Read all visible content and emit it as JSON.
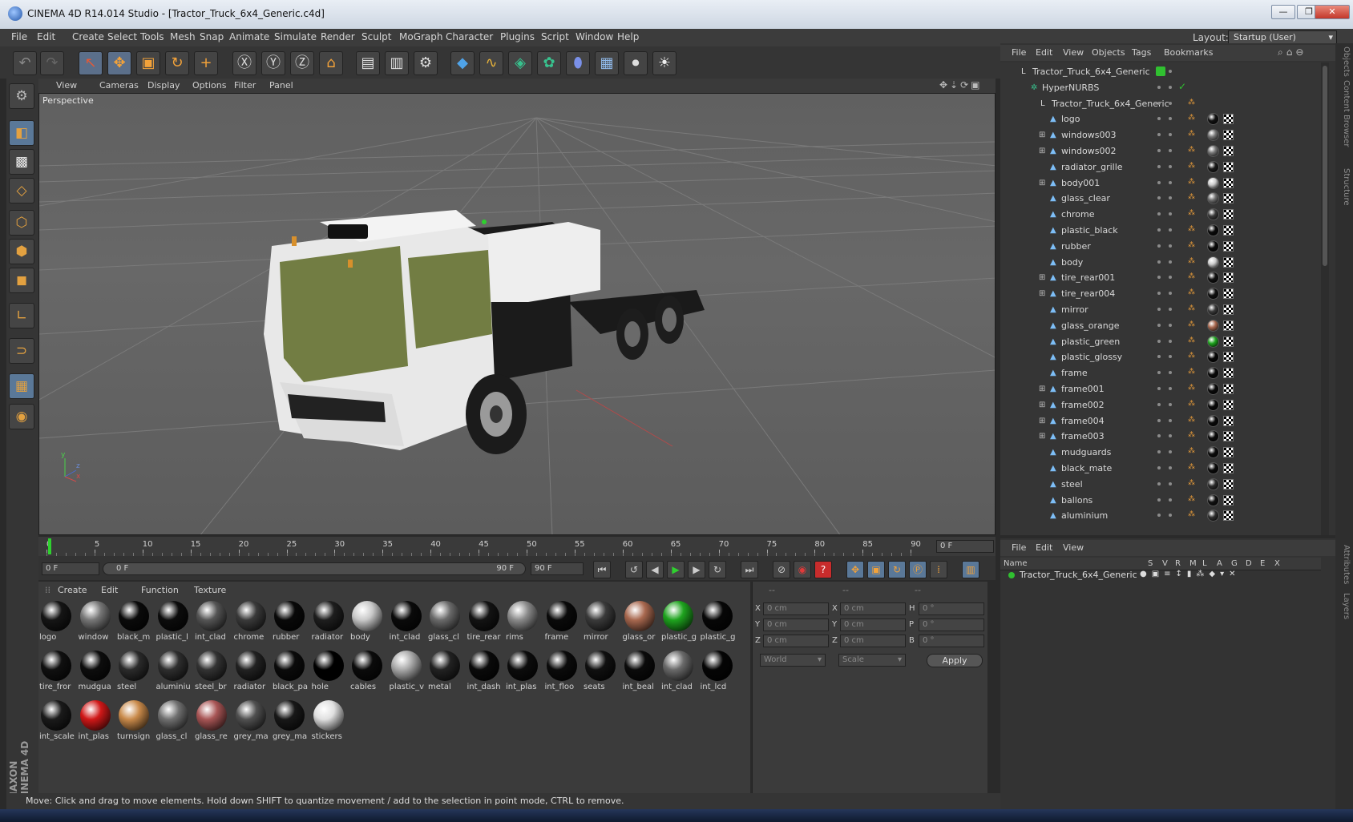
{
  "window": {
    "title": "CINEMA 4D R14.014 Studio - [Tractor_Truck_6x4_Generic.c4d]",
    "buttons": {
      "minimize": "—",
      "maximize": "❐",
      "close": "✕"
    }
  },
  "menubar": {
    "items": [
      "File",
      "Edit",
      "Create",
      "Select",
      "Tools",
      "Mesh",
      "Snap",
      "Animate",
      "Simulate",
      "Render",
      "Sculpt",
      "MoGraph",
      "Character",
      "Plugins",
      "Script",
      "Window",
      "Help"
    ],
    "layout_label": "Layout:",
    "layout_value": "Startup (User)"
  },
  "viewport": {
    "menu": [
      "View",
      "Cameras",
      "Display",
      "Options",
      "Filter",
      "Panel"
    ],
    "label": "Perspective",
    "axes": {
      "y": "y",
      "z": "z",
      "x": "x"
    }
  },
  "timeline": {
    "ticks": [
      "0",
      "5",
      "10",
      "15",
      "20",
      "25",
      "30",
      "35",
      "40",
      "45",
      "50",
      "55",
      "60",
      "65",
      "70",
      "75",
      "80",
      "85",
      "90"
    ],
    "current_frame": "0 F",
    "start_field": "0 F",
    "slider_start": "0 F",
    "slider_end": "90 F",
    "end_field": "90 F"
  },
  "materials": {
    "menu": [
      "Create",
      "Edit",
      "Function",
      "Texture"
    ],
    "items": [
      {
        "label": "logo",
        "color": "#151515"
      },
      {
        "label": "window",
        "color": "#777777"
      },
      {
        "label": "black_m",
        "color": "#0a0a0a"
      },
      {
        "label": "plastic_l",
        "color": "#0c0c0c"
      },
      {
        "label": "int_clad",
        "color": "#555555"
      },
      {
        "label": "chrome",
        "color": "#3a3a3a"
      },
      {
        "label": "rubber",
        "color": "#090909"
      },
      {
        "label": "radiator",
        "color": "#1e1e1e"
      },
      {
        "label": "body",
        "color": "#c9c9c9"
      },
      {
        "label": "int_clad",
        "color": "#0a0a0a"
      },
      {
        "label": "glass_cl",
        "color": "#6a6a6a"
      },
      {
        "label": "tire_rear",
        "color": "#131313"
      },
      {
        "label": "rims",
        "color": "#8a8a8a"
      },
      {
        "label": "frame",
        "color": "#0a0a0a"
      },
      {
        "label": "mirror",
        "color": "#3a3a3a"
      },
      {
        "label": "glass_or",
        "color": "#a8684f"
      },
      {
        "label": "plastic_g",
        "color": "#1ea31e"
      },
      {
        "label": "plastic_g",
        "color": "#070707"
      },
      {
        "label": "tire_fror",
        "color": "#101010"
      },
      {
        "label": "mudgua",
        "color": "#0d0d0d"
      },
      {
        "label": "steel",
        "color": "#2b2b2b"
      },
      {
        "label": "aluminiu",
        "color": "#2e2e2e"
      },
      {
        "label": "steel_br",
        "color": "#333333"
      },
      {
        "label": "radiator",
        "color": "#222222"
      },
      {
        "label": "black_pa",
        "color": "#0b0b0b"
      },
      {
        "label": "hole",
        "color": "#000000"
      },
      {
        "label": "cables",
        "color": "#0b0b0b"
      },
      {
        "label": "plastic_v",
        "color": "#aaaaaa"
      },
      {
        "label": "metal",
        "color": "#222222"
      },
      {
        "label": "int_dash",
        "color": "#0a0a0a"
      },
      {
        "label": "int_plas",
        "color": "#0c0c0c"
      },
      {
        "label": "int_floo",
        "color": "#0b0b0b"
      },
      {
        "label": "seats",
        "color": "#101010"
      },
      {
        "label": "int_beal",
        "color": "#0b0b0b"
      },
      {
        "label": "int_clad",
        "color": "#6a6a6a"
      },
      {
        "label": "int_lcd",
        "color": "#050505"
      },
      {
        "label": "int_scale",
        "color": "#1a1a1a"
      },
      {
        "label": "int_plas",
        "color": "#d01818"
      },
      {
        "label": "turnsign",
        "color": "#c98a4a"
      },
      {
        "label": "glass_cl",
        "color": "#707070"
      },
      {
        "label": "glass_re",
        "color": "#a85555"
      },
      {
        "label": "grey_ma",
        "color": "#505050"
      },
      {
        "label": "grey_ma",
        "color": "#181818"
      },
      {
        "label": "stickers",
        "color": "#e0e0e0"
      }
    ]
  },
  "coords": {
    "headers": [
      "--",
      "--",
      "--"
    ],
    "rows": [
      {
        "a": "X",
        "av": "0 cm",
        "b": "X",
        "bv": "0 cm",
        "c": "H",
        "cv": "0 °"
      },
      {
        "a": "Y",
        "av": "0 cm",
        "b": "Y",
        "bv": "0 cm",
        "c": "P",
        "cv": "0 °"
      },
      {
        "a": "Z",
        "av": "0 cm",
        "b": "Z",
        "bv": "0 cm",
        "c": "B",
        "cv": "0 °"
      }
    ],
    "mode": "World",
    "scale": "Scale",
    "apply": "Apply"
  },
  "objects": {
    "menu": [
      "File",
      "Edit",
      "View",
      "Objects",
      "Tags",
      "Bookmarks"
    ],
    "items": [
      {
        "name": "Tractor_Truck_6x4_Generic",
        "indent": 0,
        "ball": ""
      },
      {
        "name": "HyperNURBS",
        "indent": 1,
        "ball": ""
      },
      {
        "name": "Tractor_Truck_6x4_Generic",
        "indent": 2,
        "ball": ""
      },
      {
        "name": "logo",
        "indent": 3,
        "ball": "#111111"
      },
      {
        "name": "windows003",
        "indent": 3,
        "ball": "#777777"
      },
      {
        "name": "windows002",
        "indent": 3,
        "ball": "#777777"
      },
      {
        "name": "radiator_grille",
        "indent": 3,
        "ball": "#1a1a1a"
      },
      {
        "name": "body001",
        "indent": 3,
        "ball": "#cccccc"
      },
      {
        "name": "glass_clear",
        "indent": 3,
        "ball": "#707070"
      },
      {
        "name": "chrome",
        "indent": 3,
        "ball": "#3a3a3a"
      },
      {
        "name": "plastic_black",
        "indent": 3,
        "ball": "#0a0a0a"
      },
      {
        "name": "rubber",
        "indent": 3,
        "ball": "#0a0a0a"
      },
      {
        "name": "body",
        "indent": 3,
        "ball": "#cccccc"
      },
      {
        "name": "tire_rear001",
        "indent": 3,
        "ball": "#111111"
      },
      {
        "name": "tire_rear004",
        "indent": 3,
        "ball": "#111111"
      },
      {
        "name": "mirror",
        "indent": 3,
        "ball": "#3a3a3a"
      },
      {
        "name": "glass_orange",
        "indent": 3,
        "ball": "#a8684f"
      },
      {
        "name": "plastic_green",
        "indent": 3,
        "ball": "#1ea31e"
      },
      {
        "name": "plastic_glossy",
        "indent": 3,
        "ball": "#070707"
      },
      {
        "name": "frame",
        "indent": 3,
        "ball": "#0a0a0a"
      },
      {
        "name": "frame001",
        "indent": 3,
        "ball": "#0a0a0a"
      },
      {
        "name": "frame002",
        "indent": 3,
        "ball": "#0a0a0a"
      },
      {
        "name": "frame004",
        "indent": 3,
        "ball": "#0a0a0a"
      },
      {
        "name": "frame003",
        "indent": 3,
        "ball": "#0a0a0a"
      },
      {
        "name": "mudguards",
        "indent": 3,
        "ball": "#0d0d0d"
      },
      {
        "name": "black_mate",
        "indent": 3,
        "ball": "#0b0b0b"
      },
      {
        "name": "steel",
        "indent": 3,
        "ball": "#2b2b2b"
      },
      {
        "name": "ballons",
        "indent": 3,
        "ball": "#111111"
      },
      {
        "name": "aluminium",
        "indent": 3,
        "ball": "#2e2e2e"
      }
    ]
  },
  "layers": {
    "menu": [
      "File",
      "Edit",
      "View"
    ],
    "columns": [
      "Name",
      "S",
      "V",
      "R",
      "M",
      "L",
      "A",
      "G",
      "D",
      "E",
      "X"
    ],
    "row": "Tractor_Truck_6x4_Generic"
  },
  "side_tabs": [
    "Objects",
    "Content Browser",
    "Structure",
    "Attributes",
    "Layers"
  ],
  "status": "Move: Click and drag to move elements. Hold down SHIFT to quantize movement / add to the selection in point mode, CTRL to remove.",
  "brand": "MAXON CINEMA 4D",
  "colors": {
    "accent_orange": "#f2a23a",
    "selected_blue": "#5a7898",
    "green_ok": "#30c030"
  }
}
